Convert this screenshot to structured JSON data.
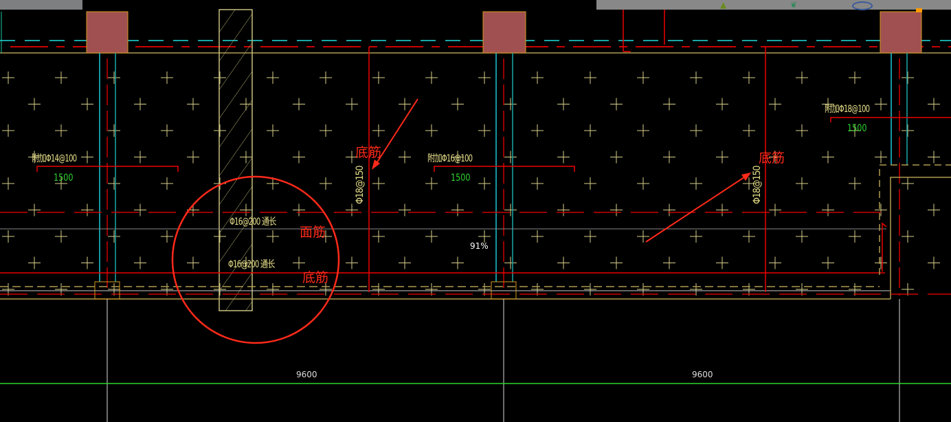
{
  "toolbar": {
    "icons": [
      "tree-icon",
      "leaf-icon",
      "ellipse-icon"
    ]
  },
  "labels": {
    "add_left": "附加Φ14@100",
    "len_left": "1500",
    "add_mid": "附加Φ16@100",
    "len_mid": "1500",
    "add_right": "附加Φ18@100",
    "len_right": "1500",
    "bottom_bar_1": "Φ18@150",
    "bottom_bar_2": "Φ18@150",
    "top_through": "Φ16@200 通长",
    "bottom_through": "Φ16@200 通长",
    "note_bottom_1": "底筋",
    "note_bottom_2": "底筋",
    "note_top": "面筋",
    "note_bottom_3": "底筋",
    "zoom_percent": "91%",
    "dim_left": "9600",
    "dim_right": "9600"
  },
  "colors": {
    "red": "#ff2a1a",
    "yellow": "#e8e08a",
    "cyan": "#1aa7a7",
    "green": "#2fd52f",
    "column": "#a05050"
  }
}
